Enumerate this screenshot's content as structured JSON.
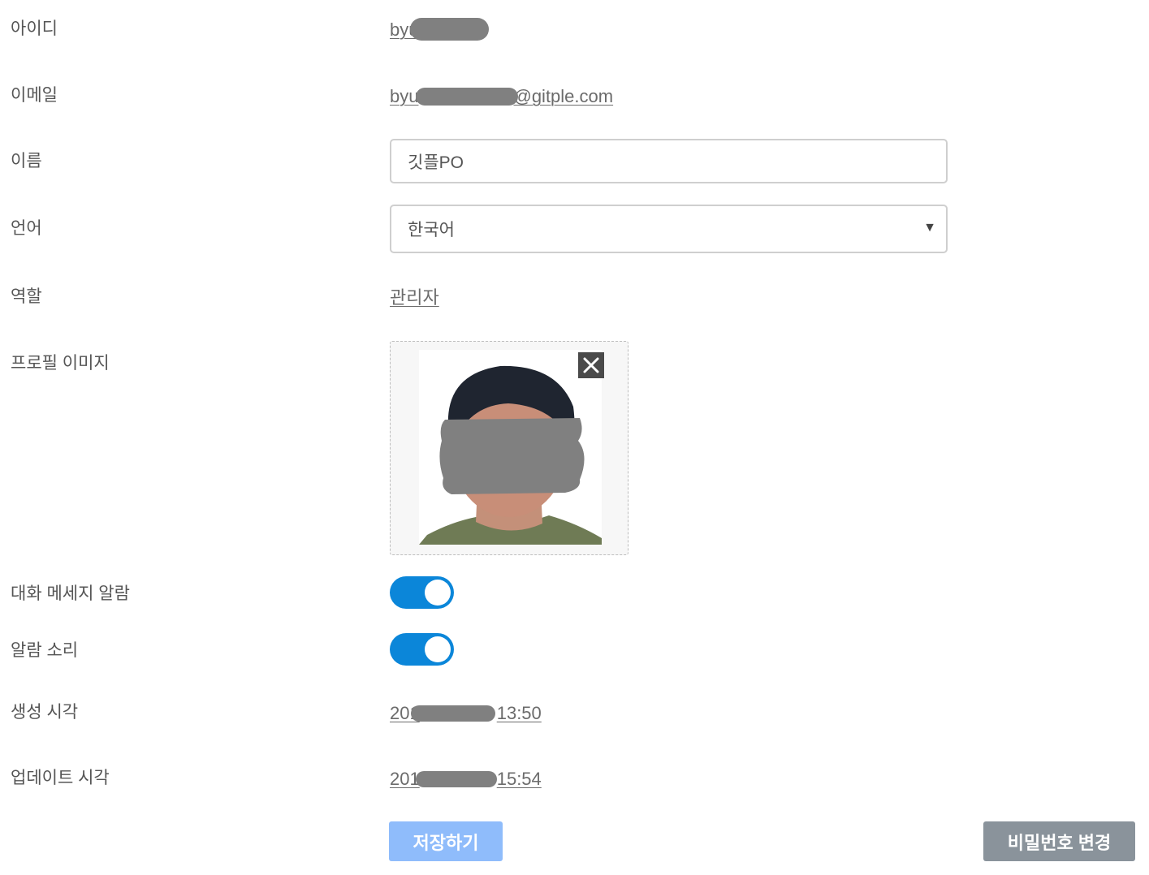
{
  "fields": {
    "id": {
      "label": "아이디",
      "value": "byu"
    },
    "email": {
      "label": "이메일",
      "value": "byu@gitple.com",
      "visible_start": "byu",
      "visible_end": "@gitple.com"
    },
    "name": {
      "label": "이름",
      "value": "깃플PO"
    },
    "language": {
      "label": "언어",
      "value": "한국어"
    },
    "role": {
      "label": "역할",
      "value": "관리자"
    },
    "profile_image": {
      "label": "프로필 이미지"
    },
    "chat_alert": {
      "label": "대화 메세지 알람",
      "enabled": true
    },
    "alert_sound": {
      "label": "알람 소리",
      "enabled": true
    },
    "created_at": {
      "label": "생성 시각",
      "value_prefix": "201",
      "value_suffix": "13:50"
    },
    "updated_at": {
      "label": "업데이트 시각",
      "value_prefix": "201",
      "value_suffix": "15:54"
    }
  },
  "buttons": {
    "save": "저장하기",
    "change_password": "비밀번호 변경"
  },
  "icons": {
    "select_arrow": "dropdown-triangle-icon",
    "remove_image": "close-icon"
  },
  "colors": {
    "toggle_on": "#0b86d9",
    "save_button": "#8fbcfb",
    "password_button": "#8a939b",
    "redaction": "#808080"
  }
}
